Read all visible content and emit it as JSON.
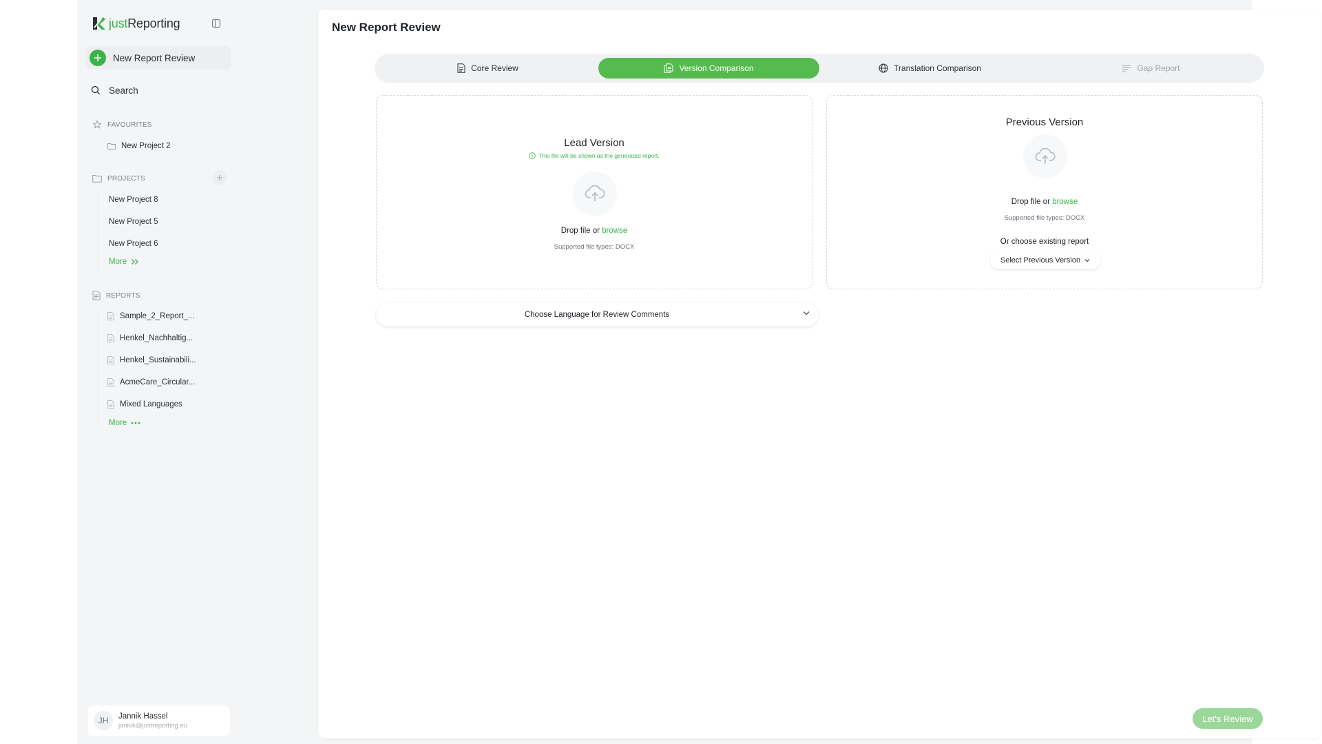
{
  "app": {
    "logo": {
      "just": "just",
      "reporting": "Reporting"
    }
  },
  "sidebar": {
    "new_review_label": "New Report Review",
    "search_label": "Search",
    "favourites": {
      "heading": "FAVOURITES",
      "items": [
        "New Project 2"
      ]
    },
    "projects": {
      "heading": "PROJECTS",
      "items": [
        "New Project 8",
        "New Project 5",
        "New Project 6"
      ],
      "more_label": "More"
    },
    "reports": {
      "heading": "REPORTS",
      "items": [
        "Sample_2_Report_...",
        "Henkel_Nachhaltig...",
        "Henkel_Sustainabili...",
        "AcmeCare_Circular...",
        "Mixed Languages"
      ],
      "more_label": "More"
    },
    "user": {
      "initials": "JH",
      "name": "Jannik Hassel",
      "email": "jannik@justreporting.eu"
    }
  },
  "main": {
    "title": "New Report Review",
    "tabs": [
      {
        "label": "Core Review",
        "icon": "document-icon",
        "state": "normal"
      },
      {
        "label": "Version Comparison",
        "icon": "compare-documents-icon",
        "state": "active"
      },
      {
        "label": "Translation Comparison",
        "icon": "globe-icon",
        "state": "normal"
      },
      {
        "label": "Gap Report",
        "icon": "list-icon",
        "state": "disabled"
      }
    ],
    "lead": {
      "title": "Lead Version",
      "hint": "This file will be shown as the generated report.",
      "drop_text": "Drop file or",
      "browse": "browse",
      "supported": "Supported file types: DOCX"
    },
    "previous": {
      "title": "Previous Version",
      "drop_text": "Drop file or",
      "browse": "browse",
      "supported": "Supported file types: DOCX",
      "or_choose": "Or choose existing report",
      "select_label": "Select Previous Version"
    },
    "language_select": "Choose Language for Review Comments",
    "review_button": "Let's Review"
  },
  "colors": {
    "accent": "#3bb54a",
    "active_tab": "#56bb4f",
    "disabled_button": "#9cd79a",
    "app_background": "#f4f5f6"
  }
}
